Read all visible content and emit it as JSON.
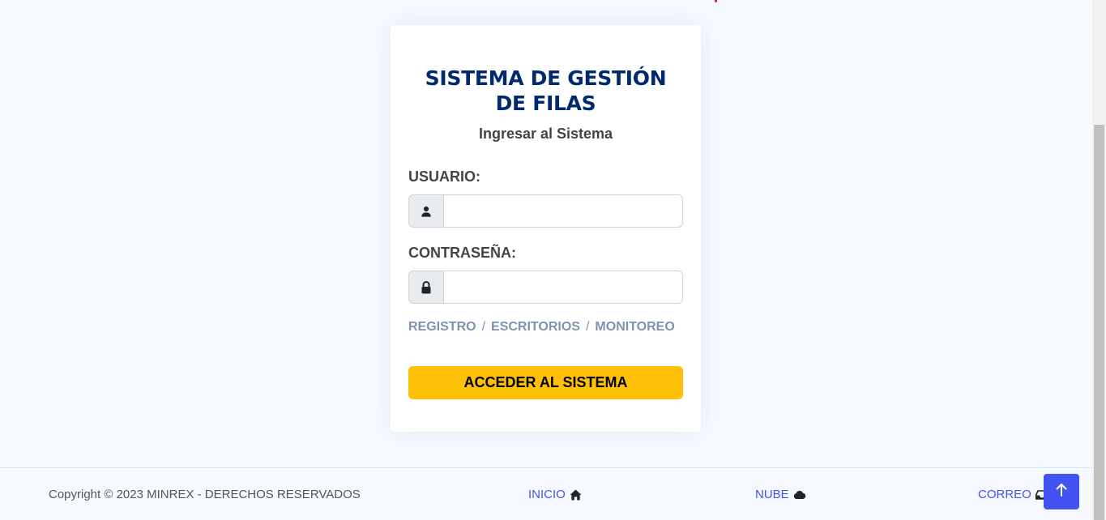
{
  "login": {
    "title": "SISTEMA DE GESTIÓN DE FILAS",
    "subtitle": "Ingresar al Sistema",
    "user_label": "USUARIO:",
    "user_value": "",
    "user_icon": "user-icon",
    "password_label": "CONTRASEÑA:",
    "password_value": "",
    "password_icon": "lock-icon",
    "links": [
      {
        "label": "REGISTRO"
      },
      {
        "label": "ESCRITORIOS"
      },
      {
        "label": "MONITOREO"
      }
    ],
    "link_separator": "/",
    "submit_label": "ACCEDER AL SISTEMA"
  },
  "footer": {
    "copyright": "Copyright © 2023 MINREX - DERECHOS RESERVADOS",
    "links": [
      {
        "label": "INICIO",
        "icon": "house-icon"
      },
      {
        "label": "NUBE",
        "icon": "cloud-icon"
      },
      {
        "label": "CORREO",
        "icon": "inbox-icon"
      }
    ]
  },
  "back_to_top_icon": "arrow-up-icon",
  "colors": {
    "background": "#f6f9ff",
    "title": "#012970",
    "accent": "#4154f1",
    "button": "#ffc107",
    "link_muted": "#7f92b0"
  }
}
